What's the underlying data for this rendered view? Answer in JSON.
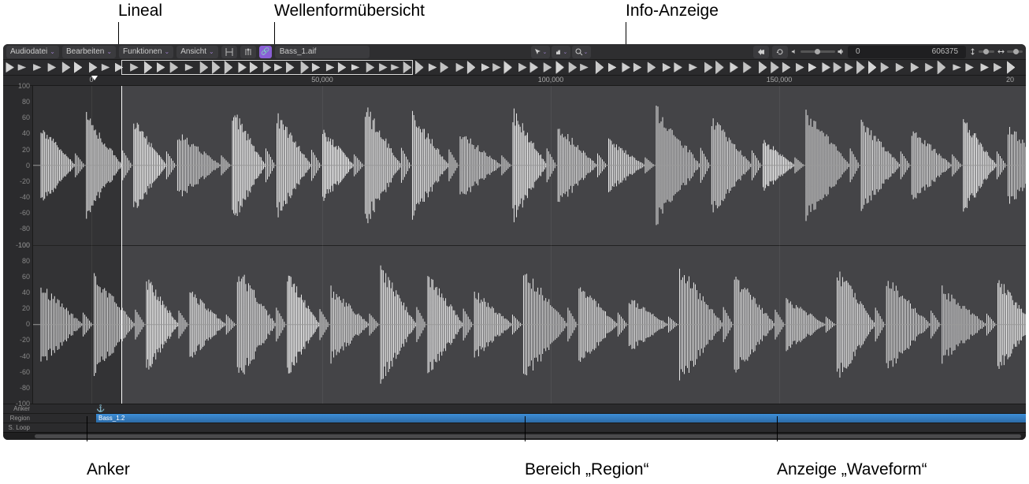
{
  "callouts": {
    "top": {
      "lineal": "Lineal",
      "wellenform": "Wellenformübersicht",
      "info": "Info-Anzeige"
    },
    "bottom": {
      "anker": "Anker",
      "region": "Bereich „Region“",
      "waveform": "Anzeige „Waveform“"
    }
  },
  "toolbar": {
    "audiodatei": "Audiodatei",
    "bearbeiten": "Bearbeiten",
    "funktionen": "Funktionen",
    "ansicht": "Ansicht",
    "filename": "Bass_1.aif"
  },
  "ruler_ticks": [
    {
      "pos": 112,
      "label": "0"
    },
    {
      "pos": 405,
      "label": "50,000"
    },
    {
      "pos": 695,
      "label": "100,000"
    },
    {
      "pos": 985,
      "label": "150,000"
    },
    {
      "pos": 1278,
      "label": "20"
    }
  ],
  "db_labels": [
    "100",
    "80",
    "60",
    "40",
    "20",
    "0",
    "-20",
    "-40",
    "-60",
    "-80",
    "-100"
  ],
  "info": {
    "pos": "0",
    "len": "606375"
  },
  "tracks": {
    "anker": "Anker",
    "region": "Region",
    "sloop": "S. Loop",
    "region_name": "Bass_1.2"
  }
}
